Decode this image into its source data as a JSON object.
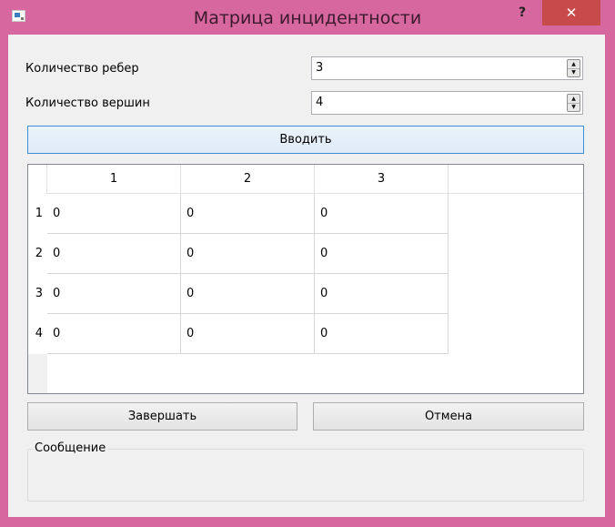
{
  "window": {
    "title": "Матрица инцидентности",
    "help_label": "?",
    "close_label": "✕",
    "icon": "app-icon"
  },
  "form": {
    "edges_label": "Количество ребер",
    "edges_value": "3",
    "vertices_label": "Количество вершин",
    "vertices_value": "4",
    "enter_button": "Вводить"
  },
  "table": {
    "columns": [
      "1",
      "2",
      "3"
    ],
    "rows": [
      {
        "header": "1",
        "cells": [
          "0",
          "0",
          "0"
        ]
      },
      {
        "header": "2",
        "cells": [
          "0",
          "0",
          "0"
        ]
      },
      {
        "header": "3",
        "cells": [
          "0",
          "0",
          "0"
        ]
      },
      {
        "header": "4",
        "cells": [
          "0",
          "0",
          "0"
        ]
      }
    ]
  },
  "actions": {
    "finish_button": "Завершать",
    "cancel_button": "Отмена"
  },
  "message": {
    "group_title": "Сообщение",
    "text": ""
  },
  "colors": {
    "frame": "#d7679f",
    "close": "#c84a4a",
    "client": "#f0f0f0",
    "focus_border": "#3c8ed6"
  }
}
